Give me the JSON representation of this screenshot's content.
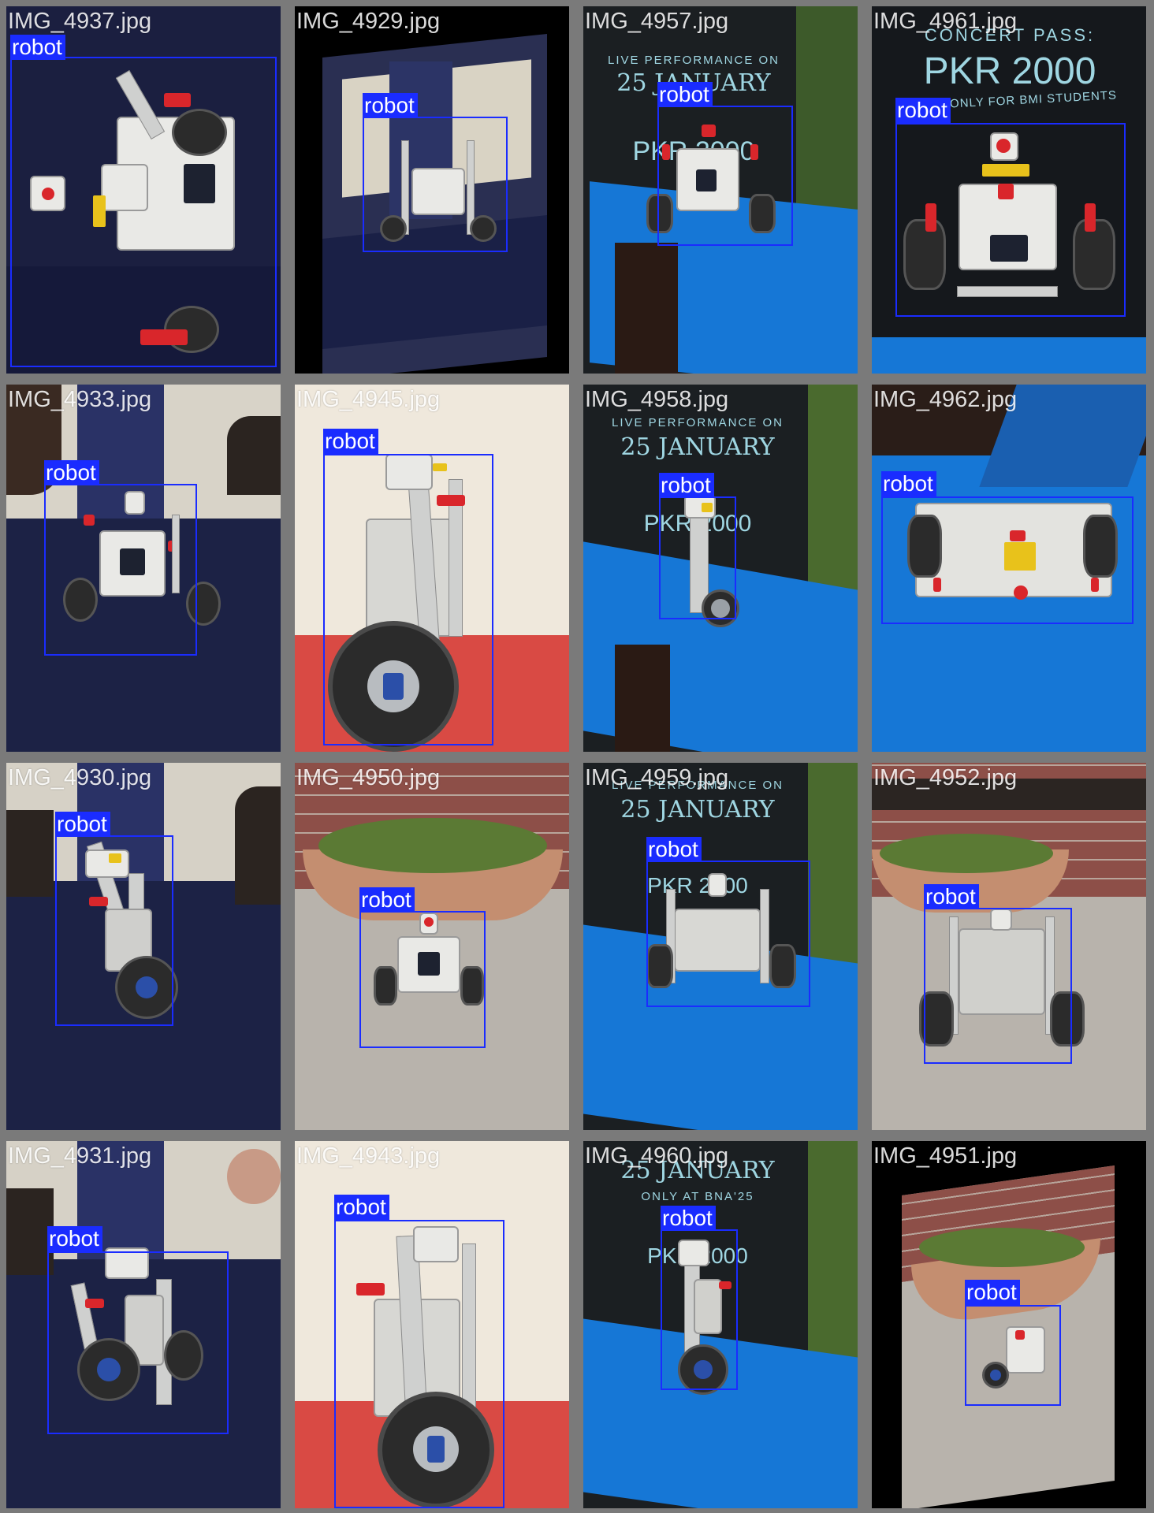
{
  "detection_label": "robot",
  "tiles": [
    {
      "filename": "IMG_4937.jpg",
      "scene": "lab-table"
    },
    {
      "filename": "IMG_4929.jpg",
      "scene": "lab-warped"
    },
    {
      "filename": "IMG_4957.jpg",
      "scene": "poster"
    },
    {
      "filename": "IMG_4961.jpg",
      "scene": "poster-close"
    },
    {
      "filename": "IMG_4933.jpg",
      "scene": "lab-table"
    },
    {
      "filename": "IMG_4945.jpg",
      "scene": "red-floor"
    },
    {
      "filename": "IMG_4958.jpg",
      "scene": "poster"
    },
    {
      "filename": "IMG_4962.jpg",
      "scene": "blue-top"
    },
    {
      "filename": "IMG_4930.jpg",
      "scene": "lab-table"
    },
    {
      "filename": "IMG_4950.jpg",
      "scene": "planter"
    },
    {
      "filename": "IMG_4959.jpg",
      "scene": "poster"
    },
    {
      "filename": "IMG_4952.jpg",
      "scene": "planter"
    },
    {
      "filename": "IMG_4931.jpg",
      "scene": "lab-table"
    },
    {
      "filename": "IMG_4943.jpg",
      "scene": "red-floor"
    },
    {
      "filename": "IMG_4960.jpg",
      "scene": "poster"
    },
    {
      "filename": "IMG_4951.jpg",
      "scene": "planter-warped"
    }
  ],
  "poster_text": {
    "live": "LIVE PERFORMANCE ON",
    "date": "25 JANUARY",
    "only": "ONLY AT BNA'25",
    "pass": "CONCERT PASS:",
    "price": "PKR 2000",
    "for": "ONLY FOR BMI STUDENTS"
  },
  "colors": {
    "bbox": "#1a2cff",
    "border": "#7a7a7a",
    "lab_table": "#1c2245",
    "poster_blue": "#1677d6",
    "red_floor": "#d94a44",
    "wall": "#efe8dc"
  }
}
